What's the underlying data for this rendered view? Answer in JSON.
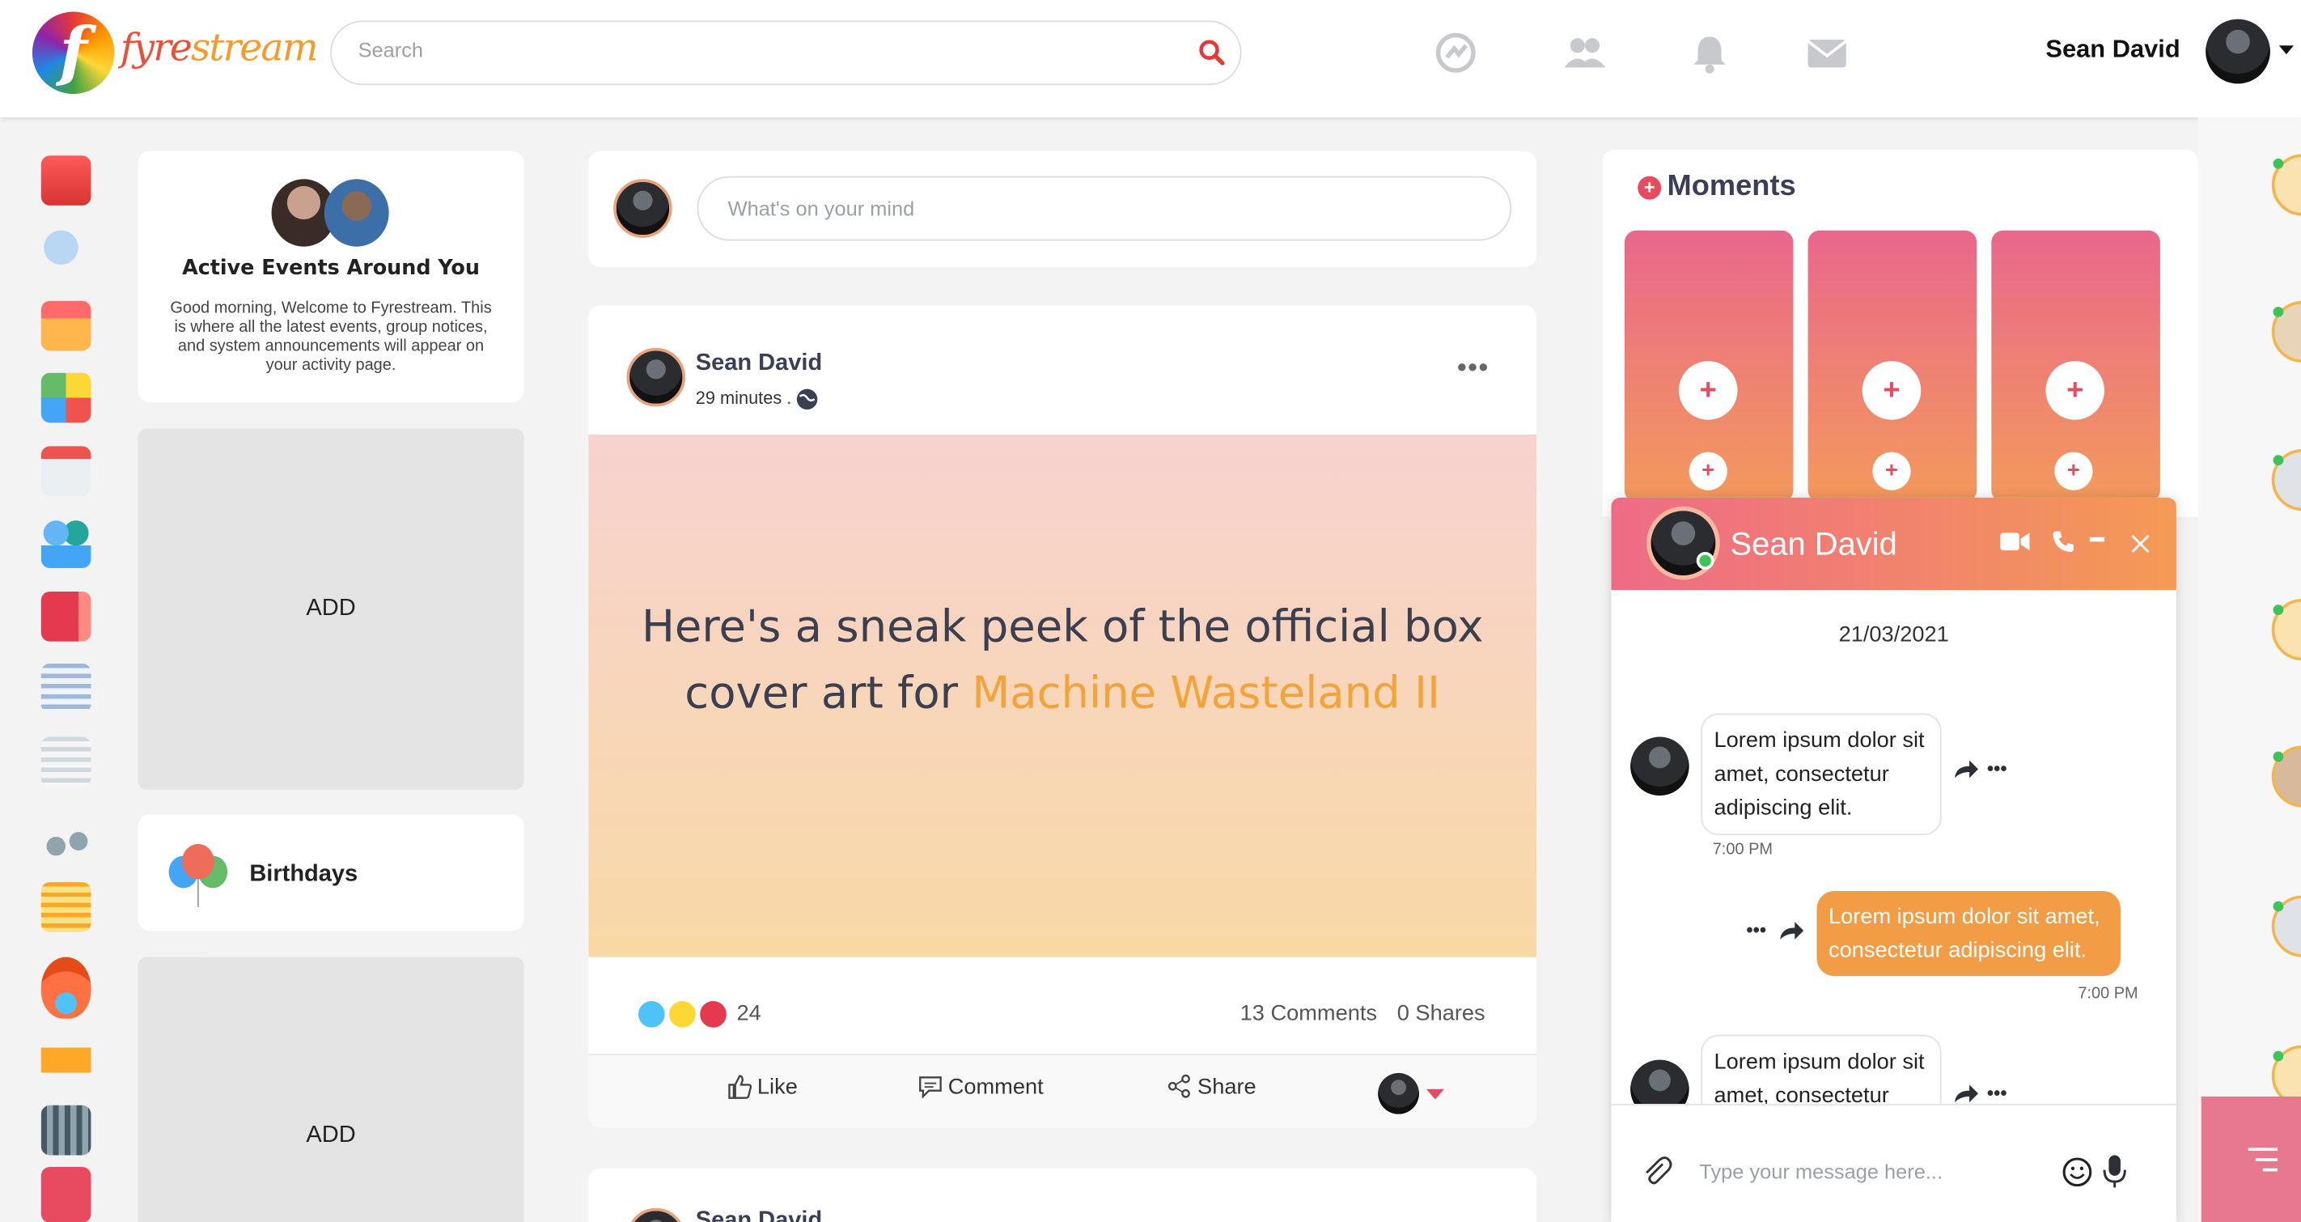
{
  "header": {
    "logo_letter": "f",
    "logo_text_a": "fyre",
    "logo_text_b": "stream",
    "search_placeholder": "Search",
    "user_name": "Sean David"
  },
  "left": {
    "events_title": "Active Events Around You",
    "events_text": "Good morning, Welcome to Fyrestream. This is where all the latest events, group notices, and system announcements will appear on your activity page.",
    "ad_label_1": "ADD",
    "birthdays_label": "Birthdays",
    "ad_label_2": "ADD"
  },
  "composer": {
    "placeholder": "What's on your mind"
  },
  "post": {
    "author": "Sean David",
    "time": "29 minutes .",
    "text_before": "Here's a sneak peek of the official box cover art for ",
    "text_highlight": "Machine Wasteland II",
    "reaction_count": "24",
    "comments": "13 Comments",
    "shares": "0 Shares",
    "like_label": "Like",
    "comment_label": "Comment",
    "share_label": "Share",
    "next_author": "Sean David"
  },
  "moments": {
    "title": "Moments"
  },
  "chat": {
    "name": "Sean David",
    "date": "21/03/2021",
    "messages": [
      {
        "text": "Lorem ipsum dolor sit amet, consectetur adipiscing elit.",
        "time": "7:00 PM"
      },
      {
        "text": "Lorem ipsum dolor sit amet, consectetur adipiscing elit.",
        "time": "7:00 PM"
      },
      {
        "text": "Lorem ipsum dolor sit amet, consectetur",
        "time": ""
      }
    ],
    "input_placeholder": "Type your message here..."
  },
  "colors": {
    "accent_orange": "#f29d45",
    "accent_pink": "#ee6b86",
    "search_red": "#e53935"
  }
}
